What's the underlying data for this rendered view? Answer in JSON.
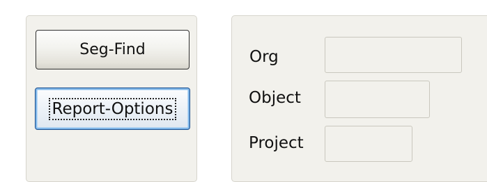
{
  "buttons": {
    "seg_find_label": "Seg-Find",
    "report_options_label": "Report-Options"
  },
  "fields": {
    "org": {
      "label": "Org",
      "value": ""
    },
    "object": {
      "label": "Object",
      "value": ""
    },
    "project": {
      "label": "Project",
      "value": ""
    }
  }
}
